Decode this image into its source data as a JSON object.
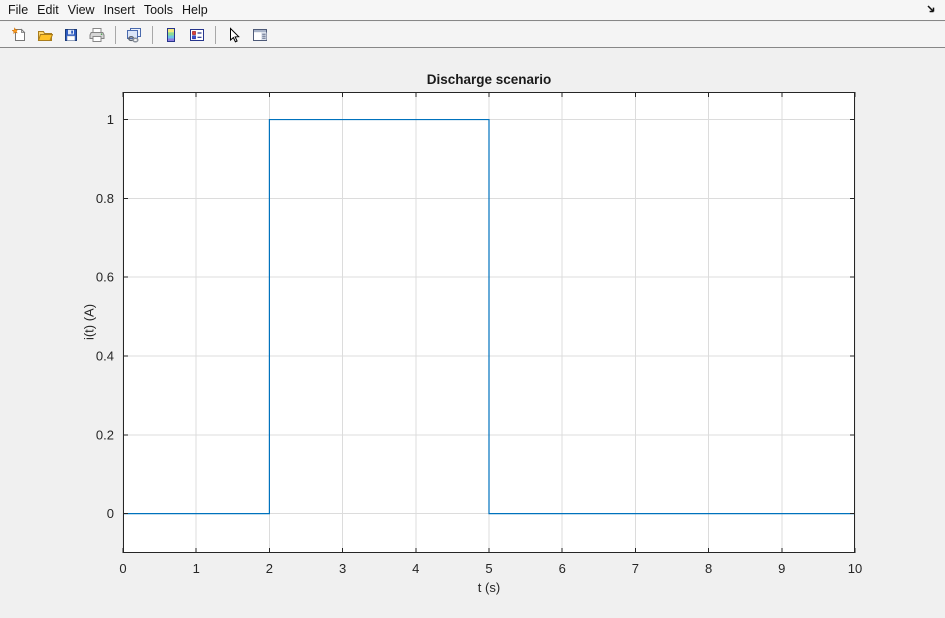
{
  "menubar": {
    "items": [
      "File",
      "Edit",
      "View",
      "Insert",
      "Tools",
      "Help"
    ],
    "corner_icon": "dock-arrow-icon"
  },
  "toolbar": {
    "icons": [
      "new-figure-icon",
      "open-icon",
      "save-icon",
      "print-icon",
      "link-plot-icon",
      "colorbar-icon",
      "legend-icon",
      "edit-plot-icon",
      "plot-tools-icon"
    ]
  },
  "colors": {
    "figure_bg": "#f0f0f0",
    "axes_bg": "#ffffff",
    "grid": "#dcdcdc",
    "axis": "#262626",
    "line": "#0072bd"
  },
  "chart_data": {
    "type": "line",
    "title": "Discharge scenario",
    "xlabel": "t (s)",
    "ylabel": "i(t) (A)",
    "xlim": [
      0,
      10
    ],
    "ylim": [
      -0.1,
      1.07
    ],
    "xticks": [
      0,
      1,
      2,
      3,
      4,
      5,
      6,
      7,
      8,
      9,
      10
    ],
    "yticks": [
      0,
      0.2,
      0.4,
      0.6,
      0.8,
      1
    ],
    "grid": true,
    "box": true,
    "line_color": "#0072bd",
    "series": [
      {
        "name": "i(t)",
        "x": [
          0,
          2,
          2,
          5,
          5,
          10
        ],
        "y": [
          0,
          0,
          1,
          1,
          0,
          0
        ],
        "description": "current pulse: 0 A for t<2 s, 1 A for 2<=t<5 s, 0 A for t>=5 s"
      }
    ]
  }
}
